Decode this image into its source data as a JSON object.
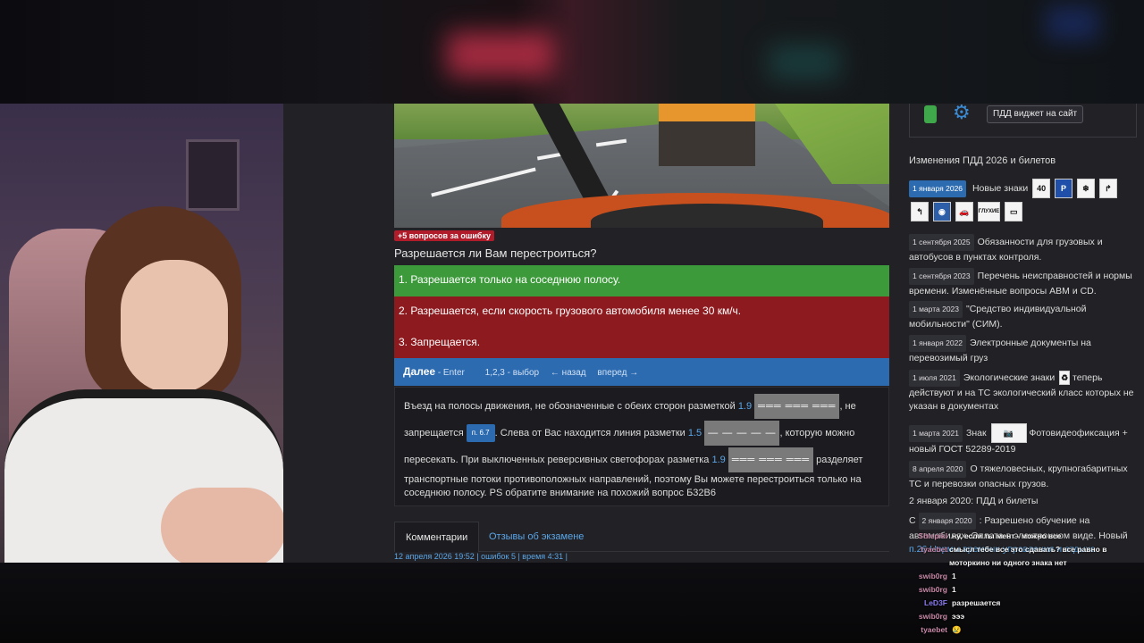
{
  "question": {
    "error_badge": "+5 вопросов за ошибку",
    "text": "Разрешается ли Вам перестроиться?",
    "answers": [
      "1. Разрешается только на соседнюю полосу.",
      "2. Разрешается, если скорость грузового автомобиля менее 30 км/ч.",
      "3. Запрещается."
    ],
    "answer_states": [
      "correct",
      "wrong",
      "wrong"
    ]
  },
  "nav": {
    "next": "Далее",
    "next_hint": "- Enter",
    "select_hint": "1,2,3 - выбор",
    "back": "← назад",
    "forward": "вперед →"
  },
  "explanation": {
    "p1a": "Въезд на полосы движения, не обозначенные с обеих сторон разметкой",
    "ref1": "1.9",
    "mark1": "═══ ═══ ═══",
    "p1b": ", не",
    "p2a": "запрещается",
    "pill": "п. 6.7",
    "p2b": ". Слева от Вас находится линия разметки",
    "ref2": "1.5",
    "mark2": "— — — — —",
    "p2c": ", которую можно",
    "p3a": "пересекать. При выключенных реверсивных светофорах разметка",
    "ref3": "1.9",
    "mark3": "═══ ═══ ═══",
    "p3b": "разделяет",
    "p4": "транспортные потоки противоположных направлений, поэтому Вы можете перестроиться только на",
    "p5": "соседнюю полосу. PS обратите внимание на похожий вопрос Б32В6"
  },
  "tabs": {
    "comments": "Комментарии",
    "reviews": "Отзывы об экзамене"
  },
  "stamp": "12 апреля 2026 19:52 | ошибок 5 | время 4:31 |",
  "sidebar": {
    "widget_button": "ПДД виджет на сайт",
    "heading": "Изменения ПДД 2026 и билетов",
    "new_signs_date": "1 января 2026",
    "new_signs_label": "Новые знаки",
    "signs": [
      "40",
      "P",
      "ГЛУХИЕ"
    ],
    "news": [
      {
        "date": "1 сентября 2025",
        "text": "Обязанности для грузовых и автобусов в пунктах контроля."
      },
      {
        "date": "1 сентября 2023",
        "text": "Перечень неисправностей и нормы времени. Изменённые вопросы ABM и CD."
      },
      {
        "date": "1 марта 2023",
        "text": "\"Средство индивидуальной мобильности\" (СИМ)."
      },
      {
        "date": "1 января 2022",
        "text": "Электронные документы на перевозимый груз"
      },
      {
        "date": "1 июля 2021",
        "text": "Экологические знаки",
        "text2": "теперь действуют и на ТС экологический класс которых не указан в документах"
      },
      {
        "date": "1 марта 2021",
        "text": "Знак",
        "text2": "Фотовидеофиксация + новый ГОСТ 52289-2019"
      },
      {
        "date": "8 апреля 2020",
        "text": "О тяжеловесных, крупногабаритных ТС и перевозки опасных грузов."
      }
    ],
    "plain_line": "2 января 2020: ПДД и билеты",
    "last_prefix": "С",
    "last_date": "2 января 2020",
    "last_text": ": Разрешено обучение на",
    "last_tail": "автомобилях. Оплата в электронном виде. Новый",
    "last_tail2": "п.26 Нормы времени управления и отдыха"
  },
  "chat": [
    {
      "user": "Shlepiki",
      "msg": "ну, если ты мент - можно все"
    },
    {
      "user": "tyaebet",
      "msg": "смысл тебе все это сдавать? все равно в моторкино ни одного знака нет"
    },
    {
      "user": "swib0rg",
      "msg": "1"
    },
    {
      "user": "swib0rg",
      "msg": "1"
    },
    {
      "user": "LeD3F",
      "msg": "разрешается"
    },
    {
      "user": "swib0rg",
      "msg": "эээ"
    },
    {
      "user": "tyaebet",
      "msg": "😢"
    }
  ],
  "colors": {
    "correct": "#3c9a3a",
    "wrong": "#8d1a1e",
    "nav_blue": "#2d6bb0",
    "link": "#5aa6e8"
  }
}
